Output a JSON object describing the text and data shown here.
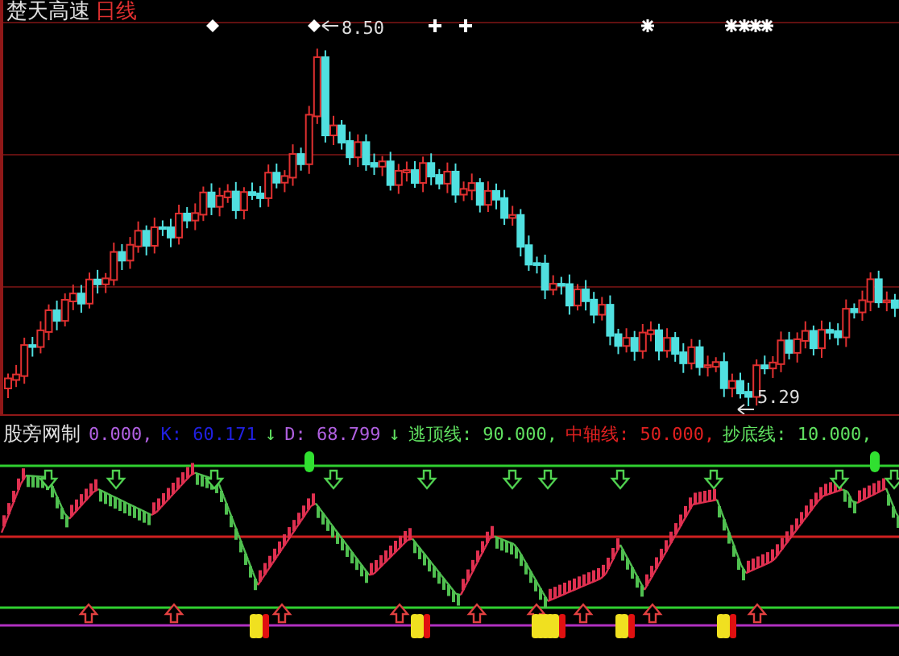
{
  "header": {
    "stock": "楚天高速",
    "period": "日线"
  },
  "price_chart": {
    "high_label": "8.50",
    "low_label": "5.29"
  },
  "indicator": {
    "name": "股旁网制",
    "legend": [
      {
        "kind": "value",
        "text": "0.000,",
        "color": "#b060e0"
      },
      {
        "kind": "value",
        "text": "K: 60.171",
        "color": "#2020e0"
      },
      {
        "kind": "arrow",
        "text": "↓",
        "color": "#60e060"
      },
      {
        "kind": "value",
        "text": "D: 68.799",
        "color": "#b060e0"
      },
      {
        "kind": "arrow",
        "text": "↓",
        "color": "#60e060"
      },
      {
        "kind": "value",
        "text": "逃顶线: 90.000,",
        "color": "#60e060"
      },
      {
        "kind": "value",
        "text": "中轴线: 50.000,",
        "color": "#e02020"
      },
      {
        "kind": "value",
        "text": "抄底线: 10.000,",
        "color": "#60e060"
      }
    ]
  }
}
